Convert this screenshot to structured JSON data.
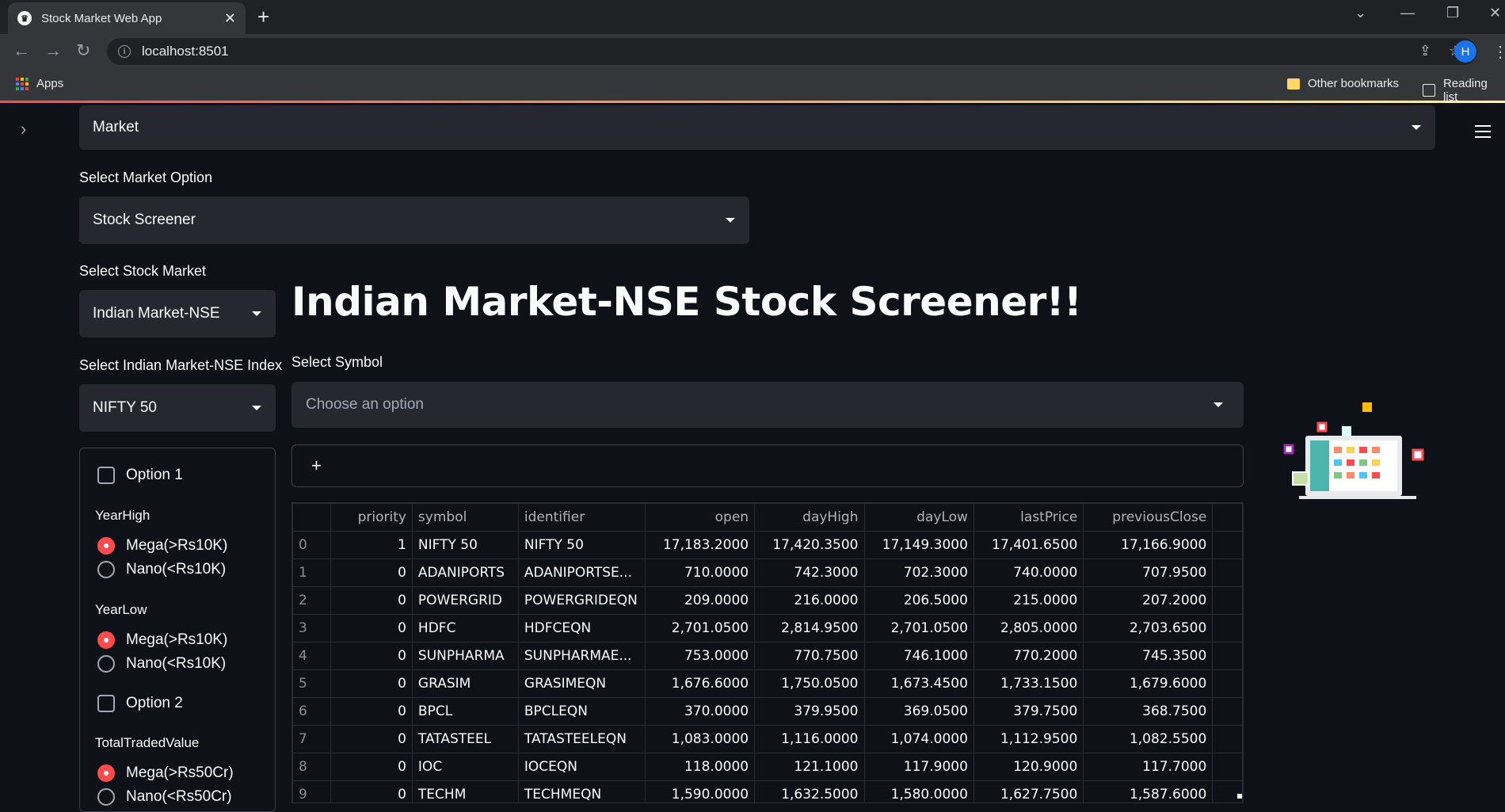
{
  "browser": {
    "tab_title": "Stock Market Web App",
    "url": "localhost:8501",
    "avatar_initial": "H",
    "bookmarks": {
      "apps": "Apps",
      "other": "Other bookmarks",
      "reading": "Reading list"
    }
  },
  "sidebar": {
    "top_select": "Market",
    "market_option_label": "Select Market Option",
    "market_option_value": "Stock Screener",
    "stock_market_label": "Select Stock Market",
    "stock_market_value": "Indian Market-NSE",
    "index_label": "Select Indian Market-NSE Index",
    "index_value": "NIFTY 50",
    "options": {
      "option1": "Option 1",
      "yearhigh_label": "YearHigh",
      "yearhigh_mega": "Mega(>Rs10K)",
      "yearhigh_nano": "Nano(<Rs10K)",
      "yearlow_label": "YearLow",
      "yearlow_mega": "Mega(>Rs10K)",
      "yearlow_nano": "Nano(<Rs10K)",
      "option2": "Option 2",
      "ttv_label": "TotalTradedValue",
      "ttv_mega": "Mega(>Rs50Cr)",
      "ttv_nano": "Nano(<Rs50Cr)"
    }
  },
  "main": {
    "title": "Indian Market-NSE Stock Screener!!",
    "symbol_label": "Select Symbol",
    "symbol_placeholder": "Choose an option",
    "expander": "+"
  },
  "table": {
    "columns": [
      "",
      "priority",
      "symbol",
      "identifier",
      "open",
      "dayHigh",
      "dayLow",
      "lastPrice",
      "previousClose"
    ],
    "rows": [
      [
        "0",
        "1",
        "NIFTY 50",
        "NIFTY 50",
        "17,183.2000",
        "17,420.3500",
        "17,149.3000",
        "17,401.6500",
        "17,166.9000"
      ],
      [
        "1",
        "0",
        "ADANIPORTS",
        "ADANIPORTSE...",
        "710.0000",
        "742.3000",
        "702.3000",
        "740.0000",
        "707.9500"
      ],
      [
        "2",
        "0",
        "POWERGRID",
        "POWERGRIDEQN",
        "209.0000",
        "216.0000",
        "206.5000",
        "215.0000",
        "207.2000"
      ],
      [
        "3",
        "0",
        "HDFC",
        "HDFCEQN",
        "2,701.0500",
        "2,814.9500",
        "2,701.0500",
        "2,805.0000",
        "2,703.6500"
      ],
      [
        "4",
        "0",
        "SUNPHARMA",
        "SUNPHARMAE...",
        "753.0000",
        "770.7500",
        "746.1000",
        "770.2000",
        "745.3500"
      ],
      [
        "5",
        "0",
        "GRASIM",
        "GRASIMEQN",
        "1,676.6000",
        "1,750.0500",
        "1,673.4500",
        "1,733.1500",
        "1,679.6000"
      ],
      [
        "6",
        "0",
        "BPCL",
        "BPCLEQN",
        "370.0000",
        "379.9500",
        "369.0500",
        "379.7500",
        "368.7500"
      ],
      [
        "7",
        "0",
        "TATASTEEL",
        "TATASTEELEQN",
        "1,083.0000",
        "1,116.0000",
        "1,074.0000",
        "1,112.9500",
        "1,082.5500"
      ],
      [
        "8",
        "0",
        "IOC",
        "IOCEQN",
        "118.0000",
        "121.1000",
        "117.9000",
        "120.9000",
        "117.7000"
      ],
      [
        "9",
        "0",
        "TECHM",
        "TECHMEQN",
        "1,590.0000",
        "1,632.5000",
        "1,580.0000",
        "1,627.7500",
        "1,587.6000"
      ]
    ]
  },
  "colors": {
    "accent": "#ff4b4b",
    "background": "#0e1117",
    "widget": "#262730"
  }
}
